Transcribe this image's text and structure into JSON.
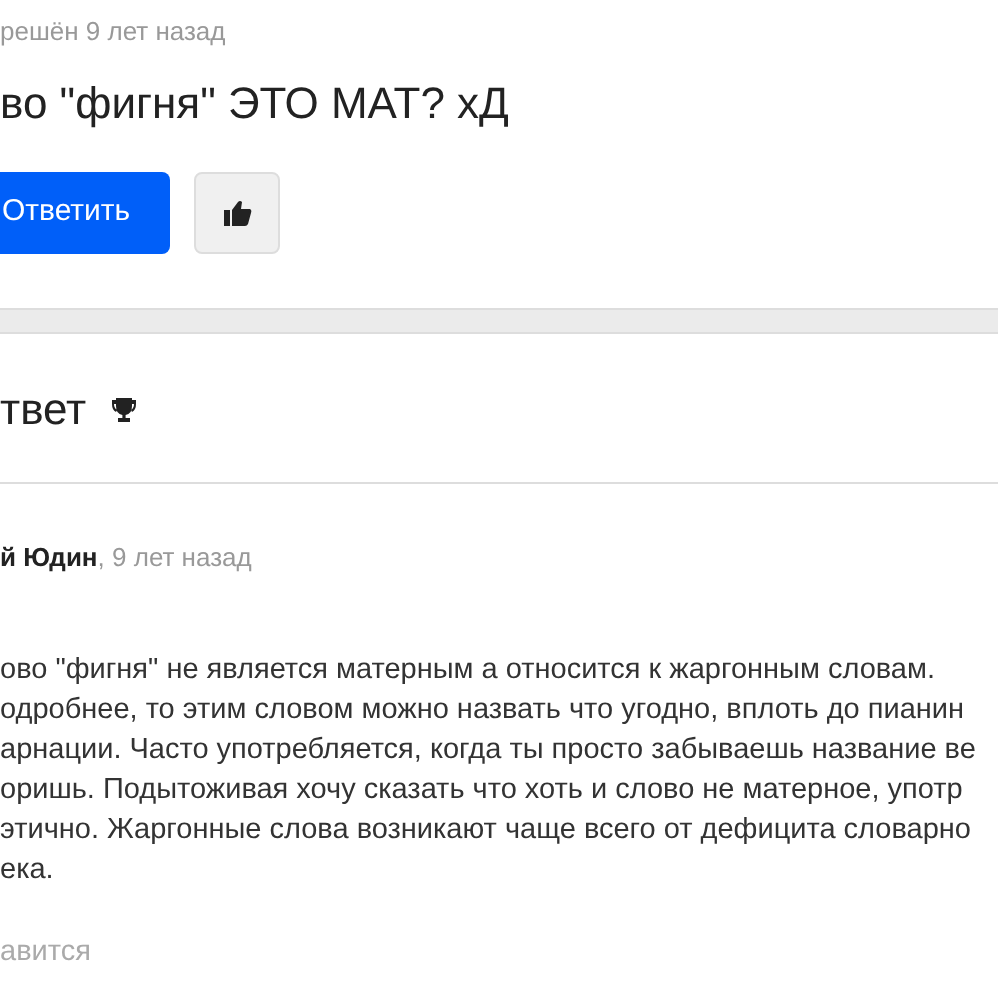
{
  "question": {
    "status": "решён 9 лет назад",
    "title": "во \"фигня\" ЭТО МАТ? хД",
    "answer_button": "Ответить"
  },
  "best_answer": {
    "heading": "твет",
    "author": "й Юдин",
    "time": ", 9 лет назад",
    "lines": [
      "ово \"фигня\" не является матерным а относится к жаргонным словам.",
      "одробнее, то этим словом можно назвать что угодно, вплоть до пианин",
      "арнации. Часто употребляется, когда ты просто забываешь название ве",
      "оришь. Подытоживая хочу сказать что хоть и слово не матерное, употр",
      "этично. Жаргонные слова возникают чаще всего от дефицита словарно",
      "ека."
    ],
    "like_label": "авится"
  }
}
